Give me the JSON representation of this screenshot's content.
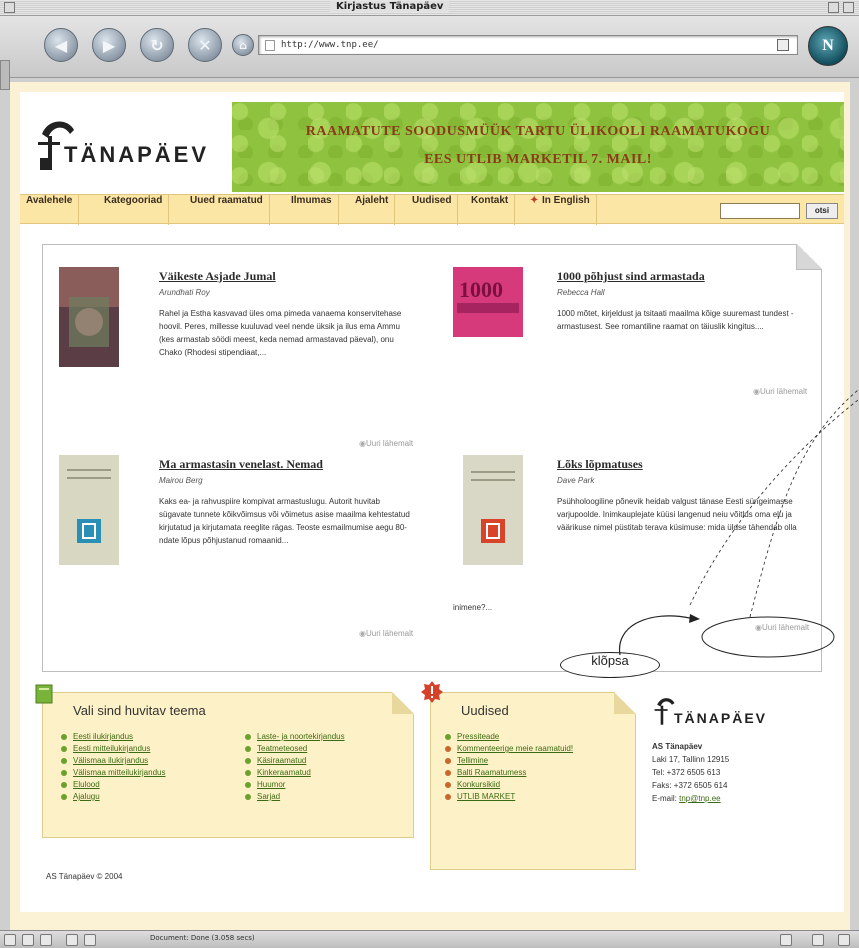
{
  "window": {
    "title": "Kirjastus Tänapäev"
  },
  "toolbar": {
    "url": "http://www.tnp.ee/"
  },
  "site": {
    "logo_text": "TÄNAPÄEV",
    "banner_line1": "RAAMATUTE SOODUSMÜÜK TARTU ÜLIKOOLI RAAMATUKOGU",
    "banner_line2": "EES UTLIB MARKETIL 7. MAIL!"
  },
  "menu": {
    "items": [
      "Avalehele",
      "Kategooriad",
      "Uued raamatud",
      "Ilmumas",
      "Ajaleht",
      "Uudised",
      "Kontakt",
      "In English"
    ],
    "search_button": "otsi"
  },
  "books": [
    {
      "title": "Väikeste Asjade Jumal",
      "author": "Arundhati Roy",
      "desc": "Rahel ja Estha kasvavad üles oma pimeda vanaema konservitehase hoovil. Peres, millesse kuuluvad veel nende üksik ja ilus ema Ammu (kes armastab söödi meest, keda nemad armastavad päeval), onu Chako (Rhodesi stipendiaat,...",
      "more": "Uuri lähemalt"
    },
    {
      "title": "1000 põhjust sind armastada",
      "author": "Rebecca Hall",
      "desc": "1000 mõtet, kirjeldust ja tsitaati maailma kõige suuremast tundest - armastusest. See romantiline raamat on täiuslik kingitus....",
      "more": "Uuri lähemalt",
      "cover_text": "1000"
    },
    {
      "title": "Ma armastasin venelast. Nemad",
      "author": "Mairou Berg",
      "desc": "Kaks ea- ja rahvuspiire kompivat armastuslugu. Autorit huvitab sügavate tunnete kõikvõimsus või võimetus asise maailma kehtestatud kirjutatud ja kirjutamata reeglite rägas. Teoste esmailmumise aegu 80-ndate lõpus põhjustanud romaanid...",
      "more": "Uuri lähemalt"
    },
    {
      "title": "Lõks lõpmatuses",
      "author": "Dave Park",
      "desc": "Psühholoogiline põnevik heidab valgust tänase Eesti süngeimasse varjupoolde. Inimkauplejate küüsi langenud neiu võitlus oma elu ja väärikuse nimel püstitab terava küsimuse: mida üldse tähendab olla",
      "overflow": "inimene?...",
      "more": "Uuri lähemalt"
    }
  ],
  "annotation": {
    "callout_text": "klõpsa"
  },
  "themes_box": {
    "title": "Vali sind huvitav teema",
    "left": [
      "Eesti ilukirjandus",
      "Eesti mitteilukirjandus",
      "Välismaa ilukirjandus",
      "Välismaa mitteilukirjandus",
      "Elulood",
      "Ajalugu"
    ],
    "right": [
      "Laste- ja noortekirjandus",
      "Teatmeteosed",
      "Käsiraamatud",
      "Kinkeraamatud",
      "Huumor",
      "Sarjad"
    ]
  },
  "news_box": {
    "title": "Uudised",
    "items": [
      "Pressiteade",
      "Kommenteerige meie raamatuid!",
      "Tellimine",
      "Balti Raamatumess",
      "Konkursikiid",
      "UTLIB MARKET"
    ]
  },
  "contact": {
    "logo_text": "TÄNAPÄEV",
    "company": "AS Tänapäev",
    "address": "Laki 17, Tallinn 12915",
    "phone": "Tel: +372 6505 613",
    "fax": "Faks: +372 6505 614",
    "email_label": "E-mail:",
    "email": "tnp@tnp.ee"
  },
  "footer": {
    "copyright": "AS Tänapäev © 2004"
  },
  "status": {
    "text": "Document: Done (3.058 secs)"
  }
}
